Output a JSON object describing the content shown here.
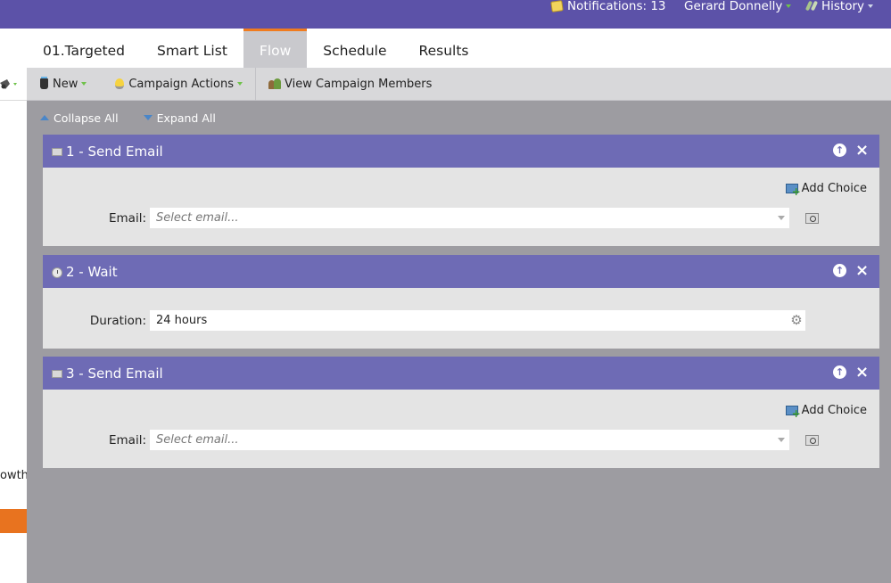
{
  "header": {
    "notifications_label": "Notifications: 13",
    "user_name": "Gerard Donnelly",
    "history_label": "History"
  },
  "left_panel": {
    "snippet_text": "owth"
  },
  "tabs": [
    {
      "label": "01.Targeted",
      "active": false
    },
    {
      "label": "Smart List",
      "active": false
    },
    {
      "label": "Flow",
      "active": true
    },
    {
      "label": "Schedule",
      "active": false
    },
    {
      "label": "Results",
      "active": false
    }
  ],
  "toolbar": {
    "new_label": "New",
    "campaign_actions_label": "Campaign Actions",
    "view_members_label": "View Campaign Members"
  },
  "expand_controls": {
    "collapse_label": "Collapse All",
    "expand_label": "Expand All"
  },
  "steps": [
    {
      "title": "1 - Send Email",
      "icon": "email-icon",
      "add_choice_label": "Add Choice",
      "field_label": "Email:",
      "field_placeholder": "Select email..."
    },
    {
      "title": "2 - Wait",
      "icon": "clock-icon",
      "field_label": "Duration:",
      "field_value": "24 hours"
    },
    {
      "title": "3 - Send Email",
      "icon": "email-icon",
      "add_choice_label": "Add Choice",
      "field_label": "Email:",
      "field_placeholder": "Select email..."
    }
  ],
  "colors": {
    "header_bg": "#5c52a8",
    "step_header_bg": "#6e6bb5",
    "active_tab_accent": "#f07b1e",
    "canvas_bg": "#9d9ca1"
  }
}
